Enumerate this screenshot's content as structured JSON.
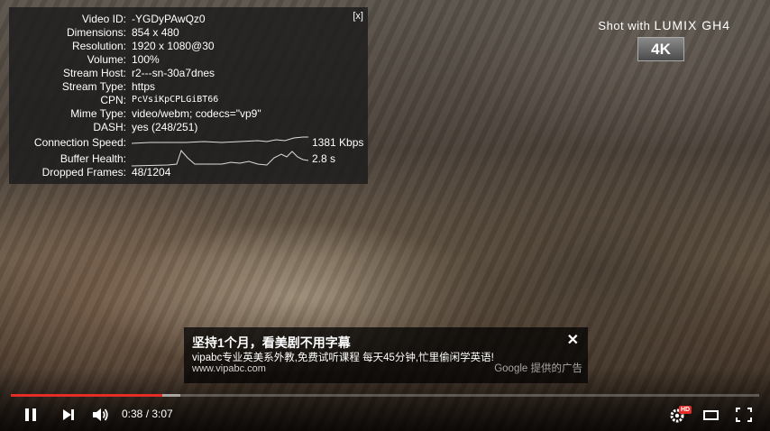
{
  "stats": {
    "close_label": "[x]",
    "rows": [
      {
        "label": "Video ID:",
        "value": "-YGDyPAwQz0"
      },
      {
        "label": "Dimensions:",
        "value": "854 x 480"
      },
      {
        "label": "Resolution:",
        "value": "1920 x 1080@30"
      },
      {
        "label": "Volume:",
        "value": "100%"
      },
      {
        "label": "Stream Host:",
        "value": "r2---sn-30a7dnes"
      },
      {
        "label": "Stream Type:",
        "value": "https"
      },
      {
        "label": "CPN:",
        "value": "PcVsiKpCPLGiBT66"
      },
      {
        "label": "Mime Type:",
        "value": "video/webm; codecs=\"vp9\""
      },
      {
        "label": "DASH:",
        "value": "yes (248/251)"
      }
    ],
    "connection": {
      "label": "Connection Speed:",
      "value": "1381 Kbps"
    },
    "buffer": {
      "label": "Buffer Health:",
      "value": "2.8 s"
    },
    "dropped": {
      "label": "Dropped Frames:",
      "value": "48/1204"
    }
  },
  "watermark": {
    "shot_with": "Shot with",
    "brand": "LUMIX GH4",
    "badge": "4K"
  },
  "ad": {
    "title": "坚持1个月，看美剧不用字幕",
    "description": "vipabc专业英美系外教,免费试听课程 每天45分钟,忙里偷闲学英语!",
    "url": "www.vipabc.com",
    "attribution": "Google 提供的广告",
    "close": "✕"
  },
  "player": {
    "current_time": "0:38",
    "duration": "3:07",
    "time_display": "0:38 / 3:07",
    "played_fraction": 0.203,
    "buffered_fraction": 0.227,
    "settings_badge": "HD"
  }
}
